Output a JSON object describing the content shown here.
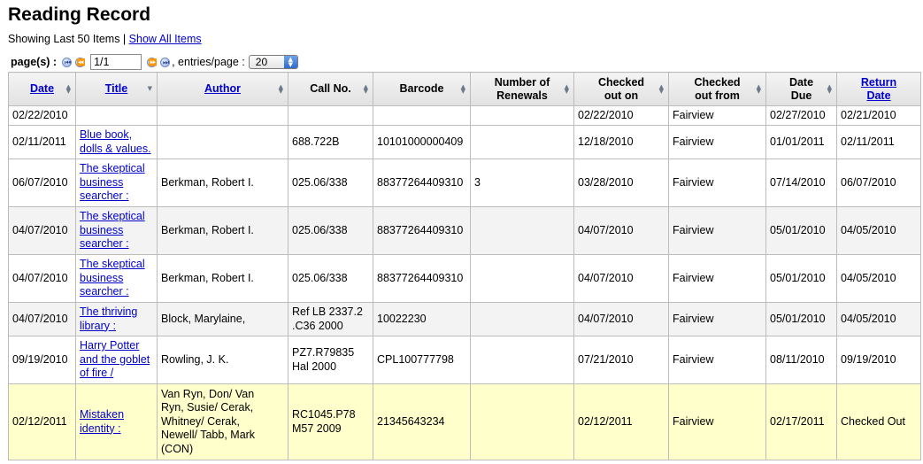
{
  "page": {
    "title": "Reading Record",
    "showing_text": "Showing Last 50 Items |",
    "show_all_label": "Show All Items"
  },
  "pager": {
    "pages_label": "page(s) :",
    "page_value": "1/1",
    "entries_label": ", entries/page :",
    "entries_selected": "20"
  },
  "table": {
    "headers": {
      "date": "Date",
      "title": "Title",
      "author": "Author",
      "callno": "Call No.",
      "barcode": "Barcode",
      "renewals_1": "Number of",
      "renewals_2": "Renewals",
      "checkedout_1": "Checked",
      "checkedout_2": "out on",
      "checkedfrom_1": "Checked",
      "checkedfrom_2": "out from",
      "datedue_1": "Date",
      "datedue_2": "Due",
      "return_1": "Return",
      "return_2": "Date"
    },
    "rows": [
      {
        "date": "02/22/2010",
        "title": [
          "",
          "",
          ""
        ],
        "author": [
          "",
          "",
          "",
          "",
          ""
        ],
        "callno": [
          "",
          ""
        ],
        "barcode": "",
        "renewals": "",
        "checkedout": "02/22/2010",
        "checkedfrom": "Fairview",
        "datedue": "02/27/2010",
        "returndate": "02/21/2010"
      },
      {
        "date": "02/11/2011",
        "title": [
          "Blue book,",
          "dolls & values.",
          ""
        ],
        "author": [
          "",
          "",
          "",
          "",
          ""
        ],
        "callno": [
          "688.722B",
          ""
        ],
        "barcode": "10101000000409",
        "renewals": "",
        "checkedout": "12/18/2010",
        "checkedfrom": "Fairview",
        "datedue": "01/01/2011",
        "returndate": "02/11/2011"
      },
      {
        "date": "06/07/2010",
        "title": [
          "The skeptical",
          "business",
          "searcher :"
        ],
        "author": [
          "Berkman, Robert I.",
          "",
          "",
          "",
          ""
        ],
        "callno": [
          "025.06/338",
          ""
        ],
        "barcode": "88377264409310",
        "renewals": "3",
        "checkedout": "03/28/2010",
        "checkedfrom": "Fairview",
        "datedue": "07/14/2010",
        "returndate": "06/07/2010"
      },
      {
        "date": "04/07/2010",
        "title": [
          "The skeptical",
          "business",
          "searcher :"
        ],
        "author": [
          "Berkman, Robert I.",
          "",
          "",
          "",
          ""
        ],
        "callno": [
          "025.06/338",
          ""
        ],
        "barcode": "88377264409310",
        "renewals": "",
        "checkedout": "04/07/2010",
        "checkedfrom": "Fairview",
        "datedue": "05/01/2010",
        "returndate": "04/05/2010"
      },
      {
        "date": "04/07/2010",
        "title": [
          "The skeptical",
          "business",
          "searcher :"
        ],
        "author": [
          "Berkman, Robert I.",
          "",
          "",
          "",
          ""
        ],
        "callno": [
          "025.06/338",
          ""
        ],
        "barcode": "88377264409310",
        "renewals": "",
        "checkedout": "04/07/2010",
        "checkedfrom": "Fairview",
        "datedue": "05/01/2010",
        "returndate": "04/05/2010"
      },
      {
        "date": "04/07/2010",
        "title": [
          "The thriving",
          "library :",
          ""
        ],
        "author": [
          "Block, Marylaine,",
          "",
          "",
          "",
          ""
        ],
        "callno": [
          "Ref LB 2337.2",
          ".C36 2000"
        ],
        "barcode": "10022230",
        "renewals": "",
        "checkedout": "04/07/2010",
        "checkedfrom": "Fairview",
        "datedue": "05/01/2010",
        "returndate": "04/05/2010"
      },
      {
        "date": "09/19/2010",
        "title": [
          "Harry Potter",
          "and the goblet",
          "of fire /"
        ],
        "author": [
          "Rowling, J. K.",
          "",
          "",
          "",
          ""
        ],
        "callno": [
          "PZ7.R79835",
          "Hal 2000"
        ],
        "barcode": "CPL100777798",
        "renewals": "",
        "checkedout": "07/21/2010",
        "checkedfrom": "Fairview",
        "datedue": "08/11/2010",
        "returndate": "09/19/2010"
      },
      {
        "date": "02/12/2011",
        "title": [
          "Mistaken",
          "identity :",
          ""
        ],
        "author": [
          "Van Ryn, Don/ Van",
          "Ryn, Susie/ Cerak,",
          "Whitney/ Cerak,",
          "Newell/ Tabb, Mark",
          "(CON)"
        ],
        "callno": [
          "RC1045.P78",
          "M57 2009"
        ],
        "barcode": "21345643234",
        "renewals": "",
        "checkedout": "02/12/2011",
        "checkedfrom": "Fairview",
        "datedue": "02/17/2011",
        "returndate": "Checked Out"
      }
    ]
  },
  "colors": {
    "link": "#0000cc",
    "row_alt": "#f3f3f3",
    "row_highlight": "#ffffcc",
    "border": "#bcbcbc"
  }
}
